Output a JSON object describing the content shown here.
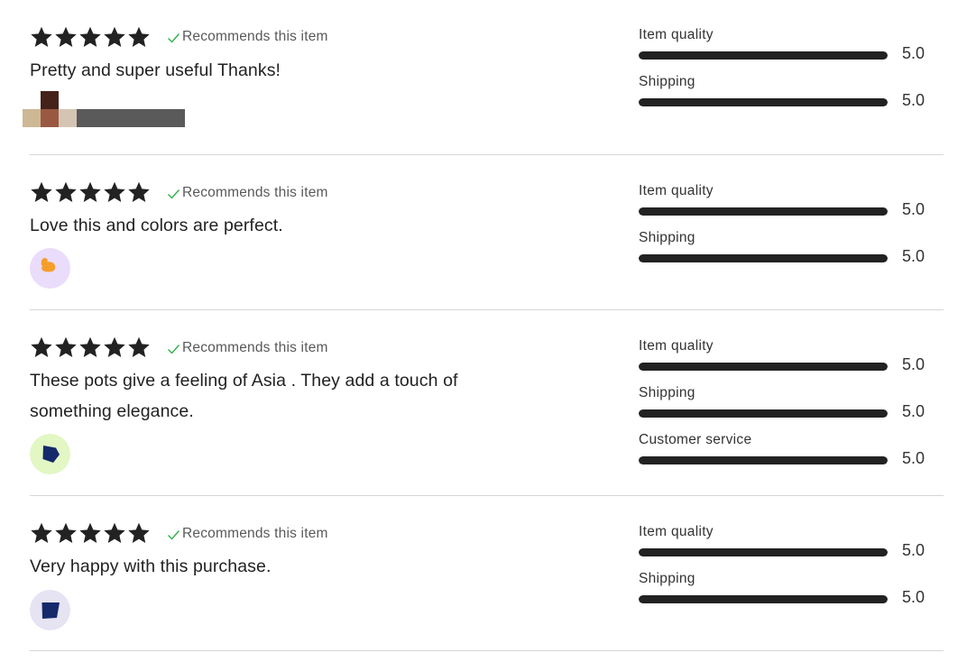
{
  "colors": {
    "star": "#222222",
    "check": "#2fb34a",
    "bar_fill": "#222222",
    "divider": "#d6d6d6"
  },
  "icons": {
    "star": "star-icon",
    "check": "checkmark-icon"
  },
  "reviews": [
    {
      "stars": 5,
      "recommend_label": "Recommends this item",
      "text": "Pretty and super useful Thanks!",
      "reviewer": {
        "type": "pixelated-image"
      },
      "ratings": [
        {
          "label": "Item quality",
          "value": "5.0",
          "fraction": 1.0
        },
        {
          "label": "Shipping",
          "value": "5.0",
          "fraction": 1.0
        }
      ]
    },
    {
      "stars": 5,
      "recommend_label": "Recommends this item",
      "text": "Love this and colors are perfect.",
      "reviewer": {
        "type": "avatar",
        "bg": "#eadcfb",
        "shape_color": "#f59e2a",
        "shape": "blob"
      },
      "ratings": [
        {
          "label": "Item quality",
          "value": "5.0",
          "fraction": 1.0
        },
        {
          "label": "Shipping",
          "value": "5.0",
          "fraction": 1.0
        }
      ]
    },
    {
      "stars": 5,
      "recommend_label": "Recommends this item",
      "text_lines": [
        "These pots give a feeling of Asia . They add a touch of",
        "something elegance."
      ],
      "text": "These pots give a feeling of Asia . They add a touch of something elegance.",
      "reviewer": {
        "type": "avatar",
        "bg": "#e2f7c3",
        "shape_color": "#142a6b",
        "shape": "pentagon"
      },
      "ratings": [
        {
          "label": "Item quality",
          "value": "5.0",
          "fraction": 1.0
        },
        {
          "label": "Shipping",
          "value": "5.0",
          "fraction": 1.0
        },
        {
          "label": "Customer service",
          "value": "5.0",
          "fraction": 1.0
        }
      ]
    },
    {
      "stars": 5,
      "recommend_label": "Recommends this item",
      "text": "Very happy with this purchase.",
      "reviewer": {
        "type": "avatar",
        "bg": "#e6e3f3",
        "shape_color": "#142a6b",
        "shape": "trapezoid"
      },
      "ratings": [
        {
          "label": "Item quality",
          "value": "5.0",
          "fraction": 1.0
        },
        {
          "label": "Shipping",
          "value": "5.0",
          "fraction": 1.0
        }
      ]
    }
  ]
}
